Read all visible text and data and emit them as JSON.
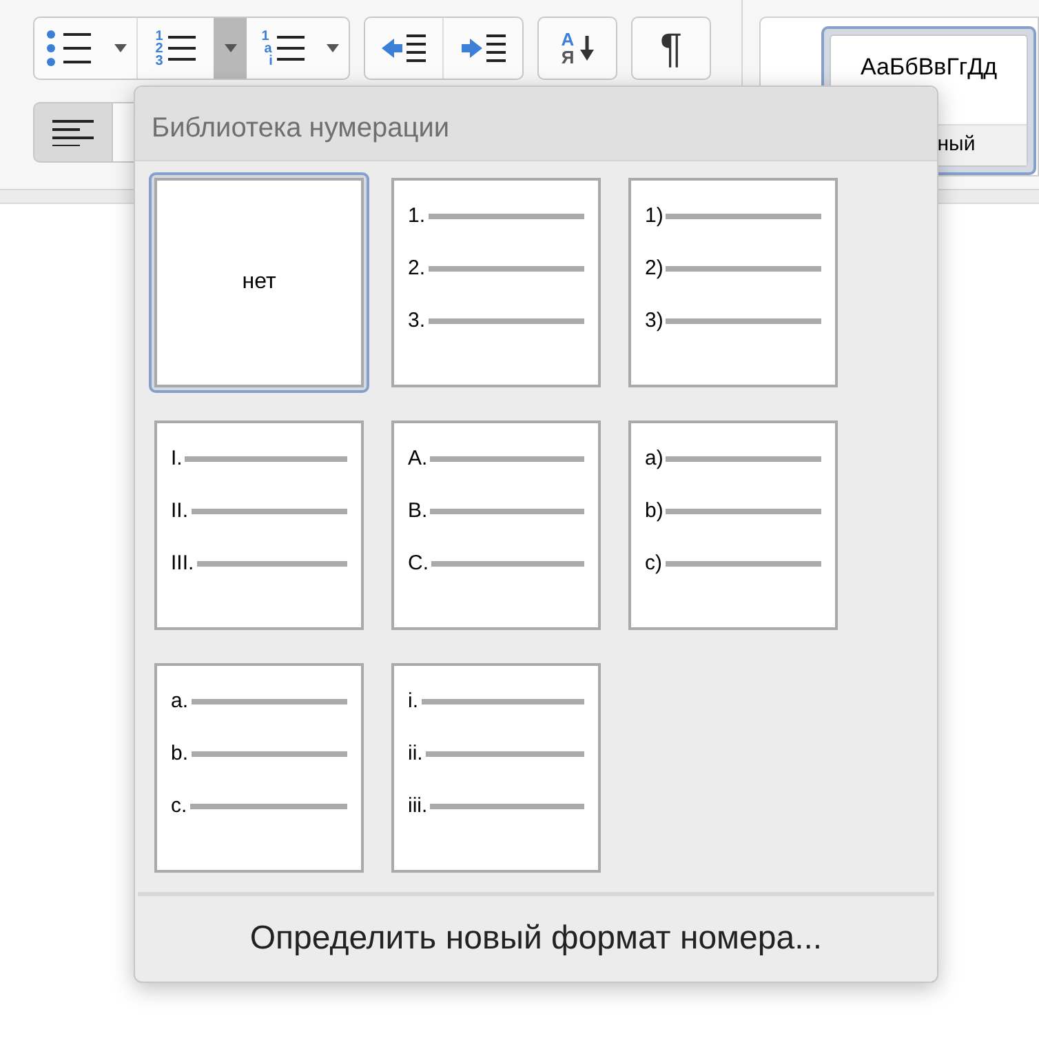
{
  "toolbar": {
    "bullet_list": {
      "dropdown_open": false
    },
    "numbered_list": {
      "digits": [
        "1",
        "2",
        "3"
      ],
      "dropdown_open": true
    },
    "multilevel_list": {
      "markers": [
        "1",
        "a",
        "i"
      ],
      "dropdown_open": false
    },
    "sort_button": {
      "letters": [
        "А",
        "Я"
      ]
    },
    "pilcrow_button": {
      "label": "¶",
      "selected": false
    },
    "align_left_button": {
      "selected": true
    },
    "style_gallery": {
      "sample": "АаБбВвГгДд",
      "style_name": "ный",
      "selected": true
    }
  },
  "numbering_menu": {
    "header": "Библиотека нумерации",
    "tiles": [
      {
        "kind": "none",
        "label": "нет",
        "selected": true
      },
      {
        "kind": "list",
        "markers": [
          "1.",
          "2.",
          "3."
        ],
        "selected": false
      },
      {
        "kind": "list",
        "markers": [
          "1)",
          "2)",
          "3)"
        ],
        "selected": false
      },
      {
        "kind": "list",
        "markers": [
          "I.",
          "II.",
          "III."
        ],
        "selected": false
      },
      {
        "kind": "list",
        "markers": [
          "A.",
          "B.",
          "C."
        ],
        "selected": false
      },
      {
        "kind": "list",
        "markers": [
          "a)",
          "b)",
          "c)"
        ],
        "selected": false
      },
      {
        "kind": "list",
        "markers": [
          "a.",
          "b.",
          "c."
        ],
        "selected": false
      },
      {
        "kind": "list",
        "markers": [
          "i.",
          "ii.",
          "iii."
        ],
        "selected": false
      }
    ],
    "footer_action": "Определить новый формат номера..."
  }
}
